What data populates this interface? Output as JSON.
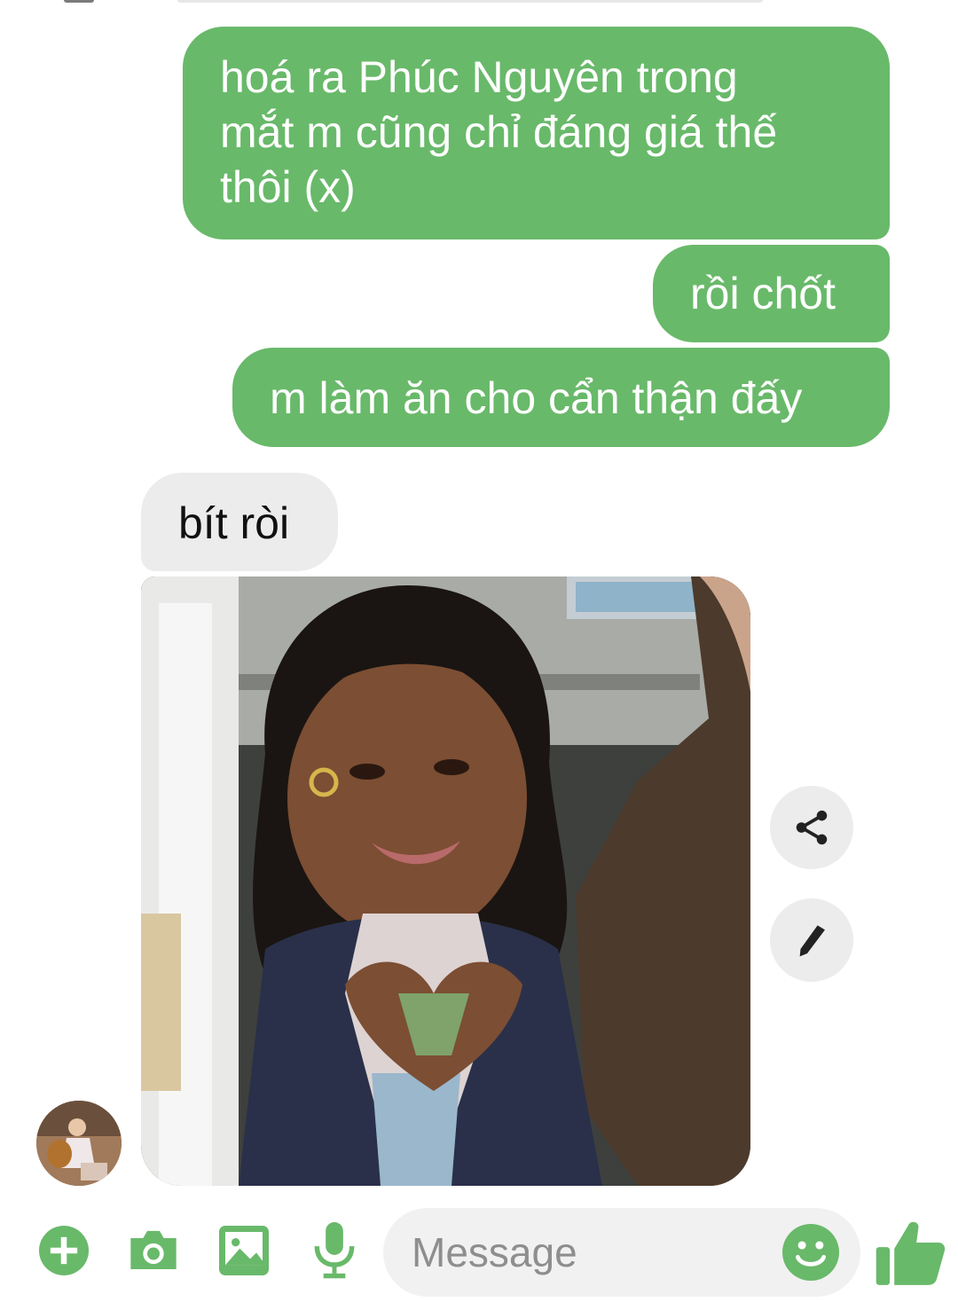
{
  "colors": {
    "accent": "#69b96a",
    "incoming_bubble": "#ececec",
    "outgoing_text": "#ffffff",
    "incoming_text": "#111111",
    "icon_gray": "#222222"
  },
  "messages": [
    {
      "direction": "outgoing",
      "text": "hoá ra Phúc Nguyên trong\nmắt m cũng chỉ đáng giá thế\nthôi (x)"
    },
    {
      "direction": "outgoing",
      "text": "rồi chốt"
    },
    {
      "direction": "outgoing",
      "text": "m làm ăn cho cẩn thận đấy"
    },
    {
      "direction": "incoming",
      "text": "bít ròi"
    },
    {
      "direction": "incoming",
      "type": "image",
      "description": "photo-message"
    }
  ],
  "photo_actions": [
    {
      "icon": "share-icon"
    },
    {
      "icon": "pencil-icon"
    }
  ],
  "composer": {
    "placeholder": "Message",
    "value": "",
    "icons": [
      "plus-circle-icon",
      "camera-icon",
      "image-icon",
      "microphone-icon",
      "emoji-icon",
      "thumbs-up-icon"
    ]
  }
}
